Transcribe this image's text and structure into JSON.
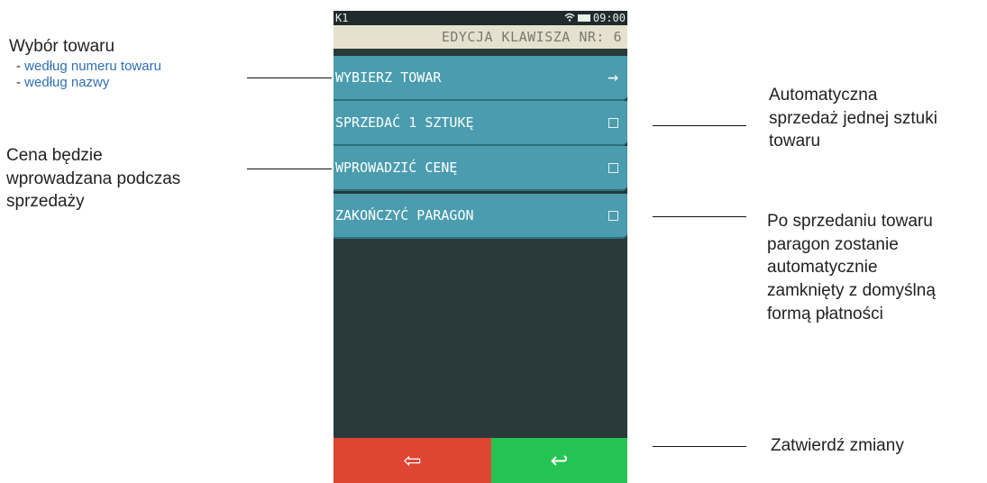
{
  "device": {
    "statusbar": {
      "left_text": "K1",
      "time": "09:00",
      "wifi_icon": "wifi-icon",
      "battery_icon": "battery-icon"
    },
    "title": "EDYCJA KLAWISZA NR: 6",
    "menu": [
      {
        "label": "WYBIERZ TOWAR",
        "control": "arrow",
        "glyph": "→"
      },
      {
        "label": "SPRZEDAĆ 1 SZTUKĘ",
        "control": "checkbox",
        "checked": false
      },
      {
        "label": "WPROWADZIĆ CENĘ",
        "control": "checkbox",
        "checked": false
      },
      {
        "label": "ZAKOŃCZYĆ PARAGON",
        "control": "checkbox",
        "checked": false
      }
    ],
    "buttons": {
      "back_glyph": "⇦",
      "confirm_glyph": "↩",
      "back_color": "#de4532",
      "confirm_color": "#25c452"
    }
  },
  "annotations": {
    "select_title": "Wybór towaru",
    "select_opt1": "według numeru towaru",
    "select_opt2": "według nazwy",
    "price_line1": "Cena będzie",
    "price_line2": "wprowadzana podczas",
    "price_line3": "sprzedaży",
    "auto_line1": "Automatyczna",
    "auto_line2": "sprzedaż jednej sztuki",
    "auto_line3": "towaru",
    "close_line1": "Po sprzedaniu towaru",
    "close_line2": "paragon zostanie",
    "close_line3": "automatycznie",
    "close_line4": "zamknięty z domyślną",
    "close_line5": "formą płatności",
    "confirm": "Zatwierdź zmiany"
  },
  "colors": {
    "menu_bg": "#4a9cae",
    "title_bg": "#e6e1cf",
    "screen_bg": "#2a3a3b",
    "link": "#2f6fb0"
  }
}
